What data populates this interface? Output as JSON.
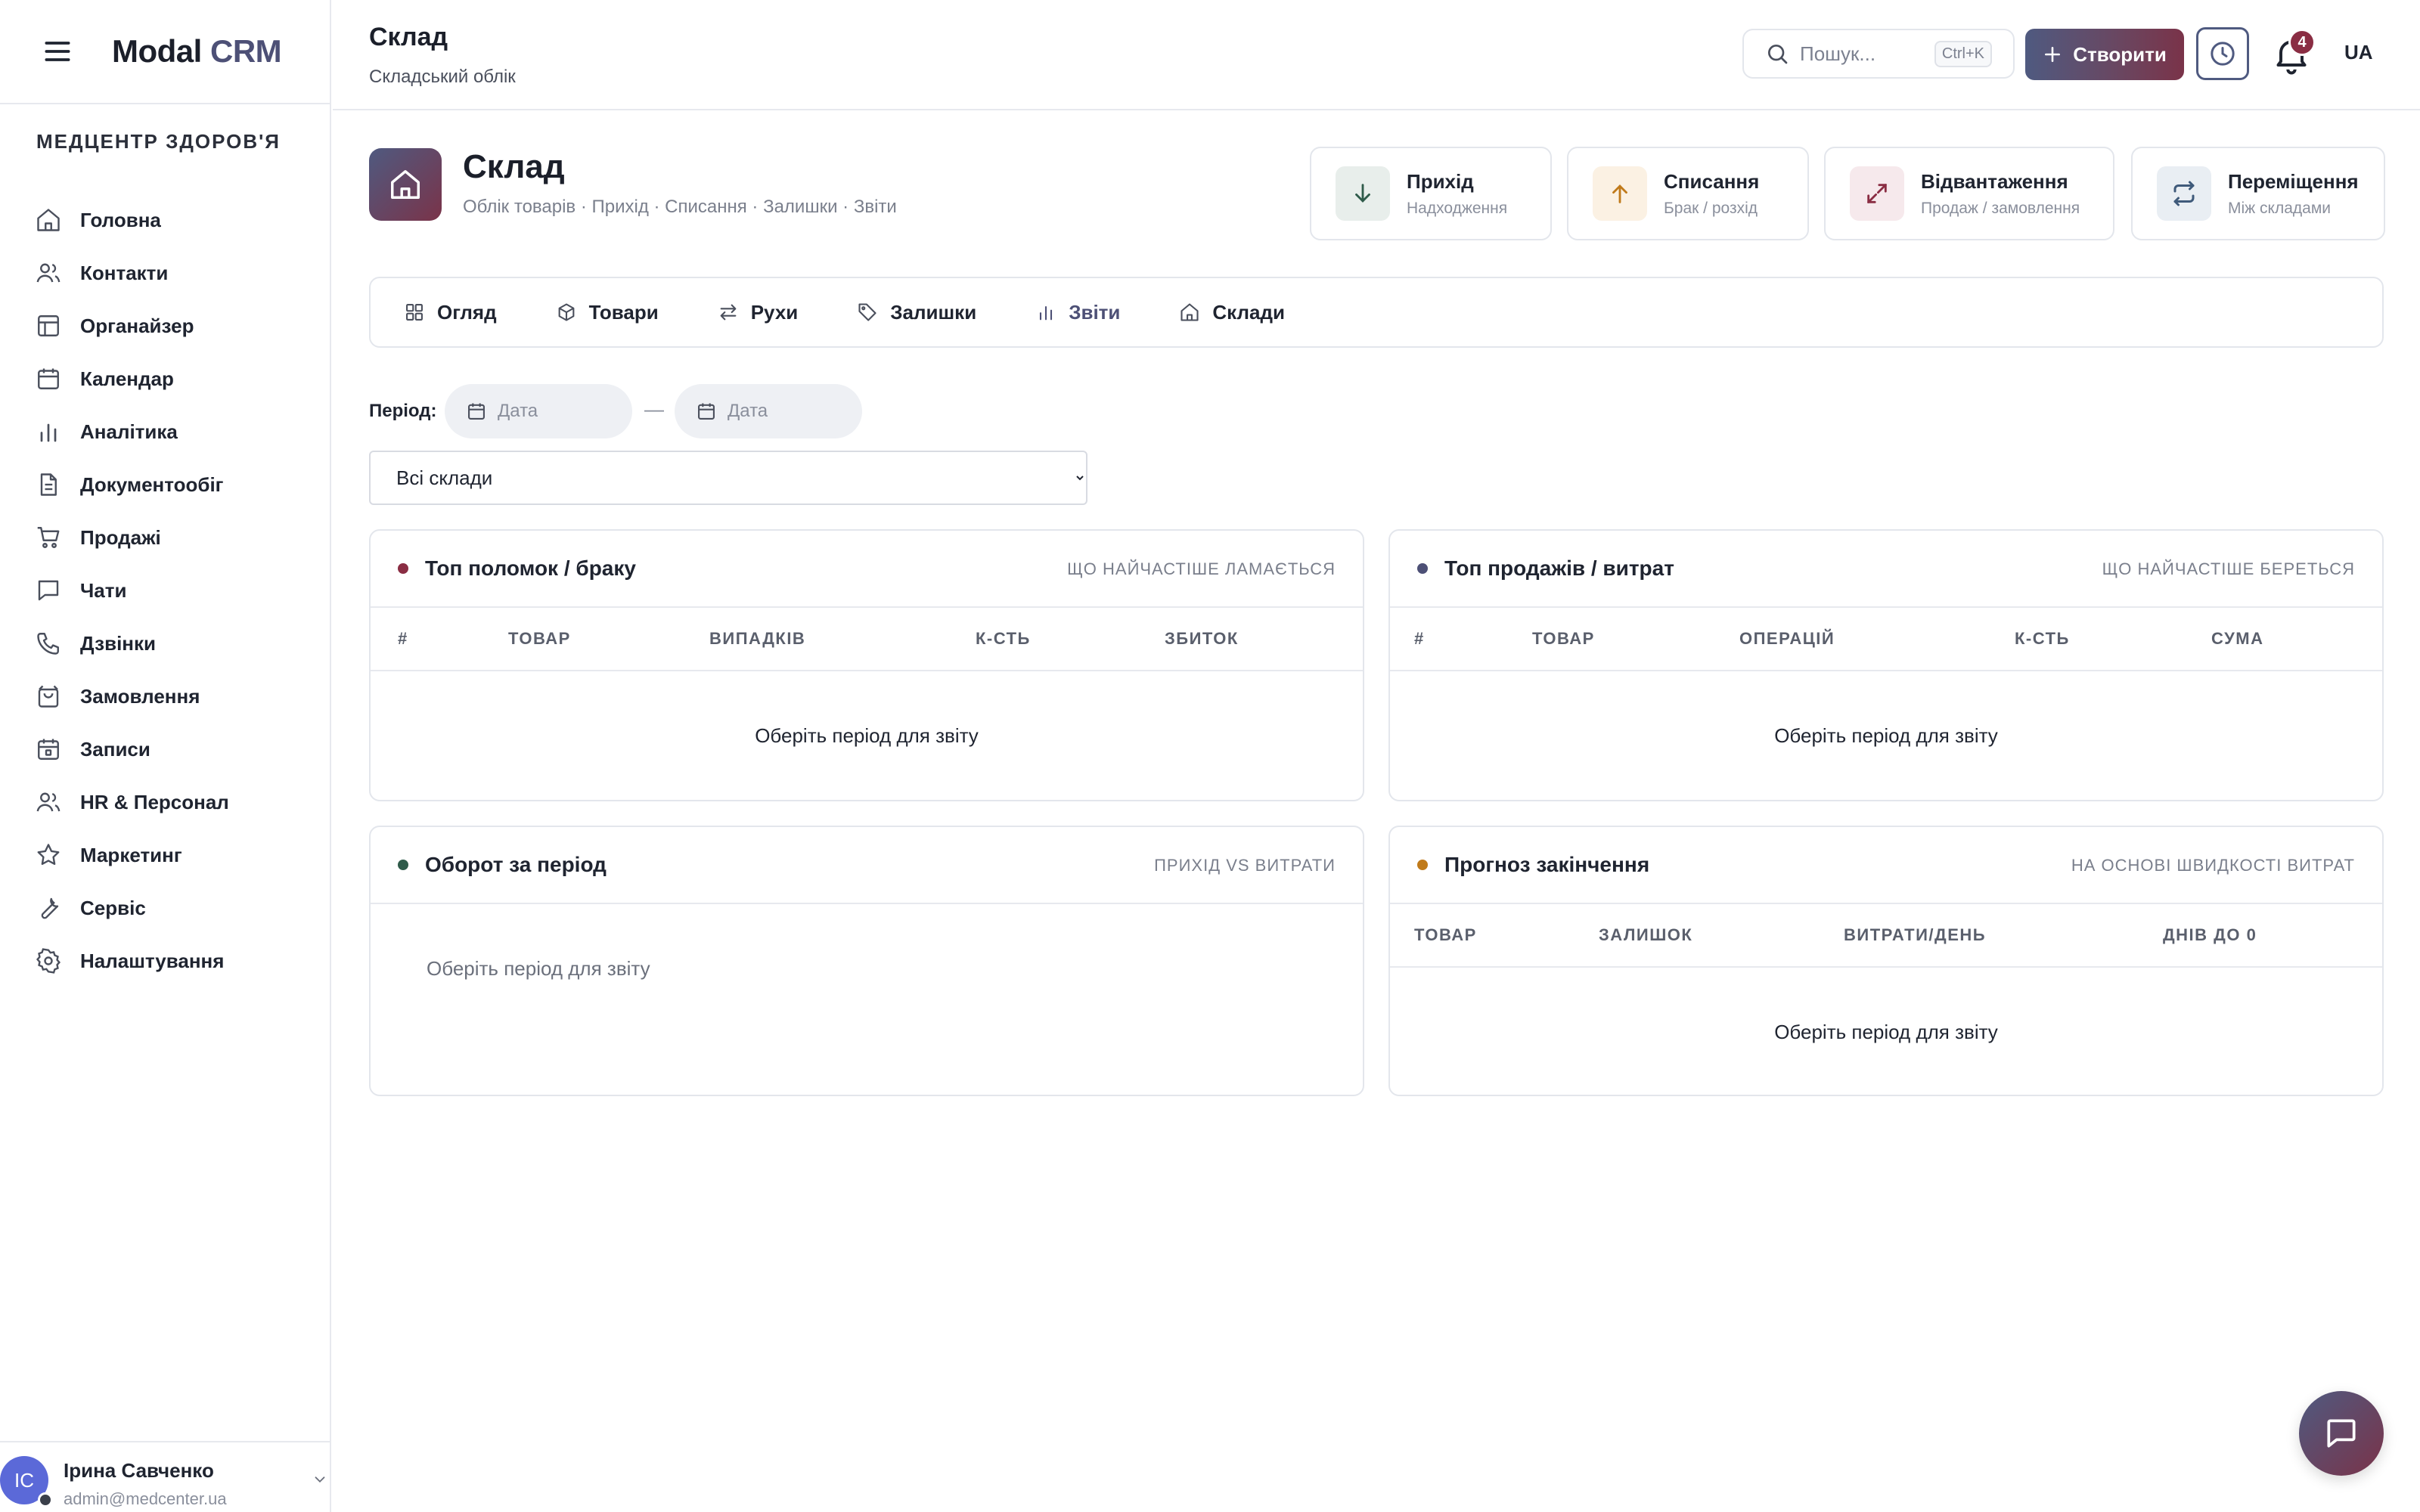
{
  "app": {
    "brand_main": "Modal",
    "brand_accent": "CRM",
    "org_name": "МЕДЦЕНТР ЗДОРОВ'Я"
  },
  "sidebar": {
    "items": [
      {
        "label": "Головна",
        "icon": "home-icon"
      },
      {
        "label": "Контакти",
        "icon": "users-icon"
      },
      {
        "label": "Органайзер",
        "icon": "layout-icon"
      },
      {
        "label": "Календар",
        "icon": "calendar-icon"
      },
      {
        "label": "Аналітика",
        "icon": "bar-chart-icon"
      },
      {
        "label": "Документообіг",
        "icon": "document-icon"
      },
      {
        "label": "Продажі",
        "icon": "cart-icon"
      },
      {
        "label": "Чати",
        "icon": "chat-icon"
      },
      {
        "label": "Дзвінки",
        "icon": "phone-icon"
      },
      {
        "label": "Замовлення",
        "icon": "bag-icon"
      },
      {
        "label": "Записи",
        "icon": "calendar-check-icon"
      },
      {
        "label": "HR & Персонал",
        "icon": "people-icon"
      },
      {
        "label": "Маркетинг",
        "icon": "star-icon"
      },
      {
        "label": "Сервіс",
        "icon": "wrench-icon"
      },
      {
        "label": "Налаштування",
        "icon": "gear-icon"
      }
    ],
    "user": {
      "initials": "ІС",
      "name": "Ірина Савченко",
      "email": "admin@medcenter.ua"
    }
  },
  "header": {
    "title": "Склад",
    "subtitle": "Складський облік",
    "search_placeholder": "Пошук...",
    "search_shortcut": "Ctrl+K",
    "create_label": "Створити",
    "notifications_count": "4",
    "language": "UA"
  },
  "hero": {
    "title": "Склад",
    "subtitle": "Облік товарів · Прихід · Списання · Залишки · Звіти"
  },
  "quick_actions": [
    {
      "title": "Прихід",
      "subtitle": "Надходження",
      "icon": "arrow-down-icon",
      "color": "#2f5b4a",
      "bg": "#e8eeeb"
    },
    {
      "title": "Списання",
      "subtitle": "Брак / розхід",
      "icon": "arrow-up-icon",
      "color": "#c07a1a",
      "bg": "#fbf1e3"
    },
    {
      "title": "Відвантаження",
      "subtitle": "Продаж / замовлення",
      "icon": "expand-icon",
      "color": "#8a2d43",
      "bg": "#f6e9ec"
    },
    {
      "title": "Переміщення",
      "subtitle": "Між складами",
      "icon": "swap-icon",
      "color": "#3f5a7a",
      "bg": "#e9eef3"
    }
  ],
  "tabs": [
    {
      "label": "Огляд",
      "icon": "grid-icon"
    },
    {
      "label": "Товари",
      "icon": "box-icon"
    },
    {
      "label": "Рухи",
      "icon": "arrows-icon"
    },
    {
      "label": "Залишки",
      "icon": "tag-icon"
    },
    {
      "label": "Звіти",
      "icon": "bar-chart-icon",
      "active": true
    },
    {
      "label": "Склади",
      "icon": "warehouse-icon"
    }
  ],
  "filters": {
    "period_label": "Період:",
    "date_from_placeholder": "Дата",
    "date_to_placeholder": "Дата",
    "separator": "—",
    "warehouse_selected": "Всі склади"
  },
  "cards": {
    "breakage": {
      "title": "Топ поломок / браку",
      "hint": "ЩО НАЙЧАСТІШЕ ЛАМАЄТЬСЯ",
      "dot_color": "#8a2d43",
      "columns": [
        "#",
        "ТОВАР",
        "ВИПАДКІВ",
        "К-СТЬ",
        "ЗБИТОК"
      ],
      "empty": "Оберіть період для звіту"
    },
    "sales": {
      "title": "Топ продажів / витрат",
      "hint": "ЩО НАЙЧАСТІШЕ БЕРЕТЬСЯ",
      "dot_color": "#4d5076",
      "columns": [
        "#",
        "ТОВАР",
        "ОПЕРАЦІЙ",
        "К-СТЬ",
        "СУМА"
      ],
      "empty": "Оберіть період для звіту"
    },
    "turnover": {
      "title": "Оборот за період",
      "hint": "ПРИХІД VS ВИТРАТИ",
      "dot_color": "#2f5b4a",
      "empty": "Оберіть період для звіту"
    },
    "forecast": {
      "title": "Прогноз закінчення",
      "hint": "НА ОСНОВІ ШВИДКОСТІ ВИТРАТ",
      "dot_color": "#c07a1a",
      "columns": [
        "ТОВАР",
        "ЗАЛИШОК",
        "ВИТРАТИ/ДЕНЬ",
        "ДНІВ ДО 0"
      ],
      "empty": "Оберіть період для звіту"
    }
  }
}
